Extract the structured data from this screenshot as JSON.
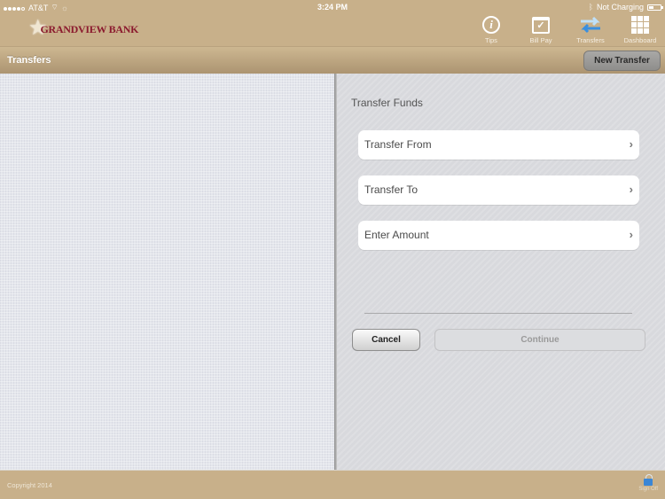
{
  "status_bar": {
    "carrier": "AT&T",
    "time": "3:24 PM",
    "charging": "Not Charging"
  },
  "brand": {
    "name": "GRANDVIEW BANK",
    "accent": "#8b1a2e",
    "bar_color": "#c8b08a"
  },
  "nav": [
    {
      "label": "Tips",
      "icon": "info-icon"
    },
    {
      "label": "Bill Pay",
      "icon": "calendar-check-icon"
    },
    {
      "label": "Transfers",
      "icon": "transfer-arrows-icon"
    },
    {
      "label": "Dashboard",
      "icon": "grid-icon"
    }
  ],
  "titlebar": {
    "title": "Transfers",
    "new_button": "New Transfer"
  },
  "form": {
    "section_title": "Transfer Funds",
    "rows": [
      {
        "label": "Transfer From"
      },
      {
        "label": "Transfer To"
      },
      {
        "label": "Enter Amount"
      }
    ],
    "chevron": "›",
    "cancel_label": "Cancel",
    "continue_label": "Continue"
  },
  "footer": {
    "copyright": "Copyright 2014",
    "signoff_label": "Sign Off"
  }
}
